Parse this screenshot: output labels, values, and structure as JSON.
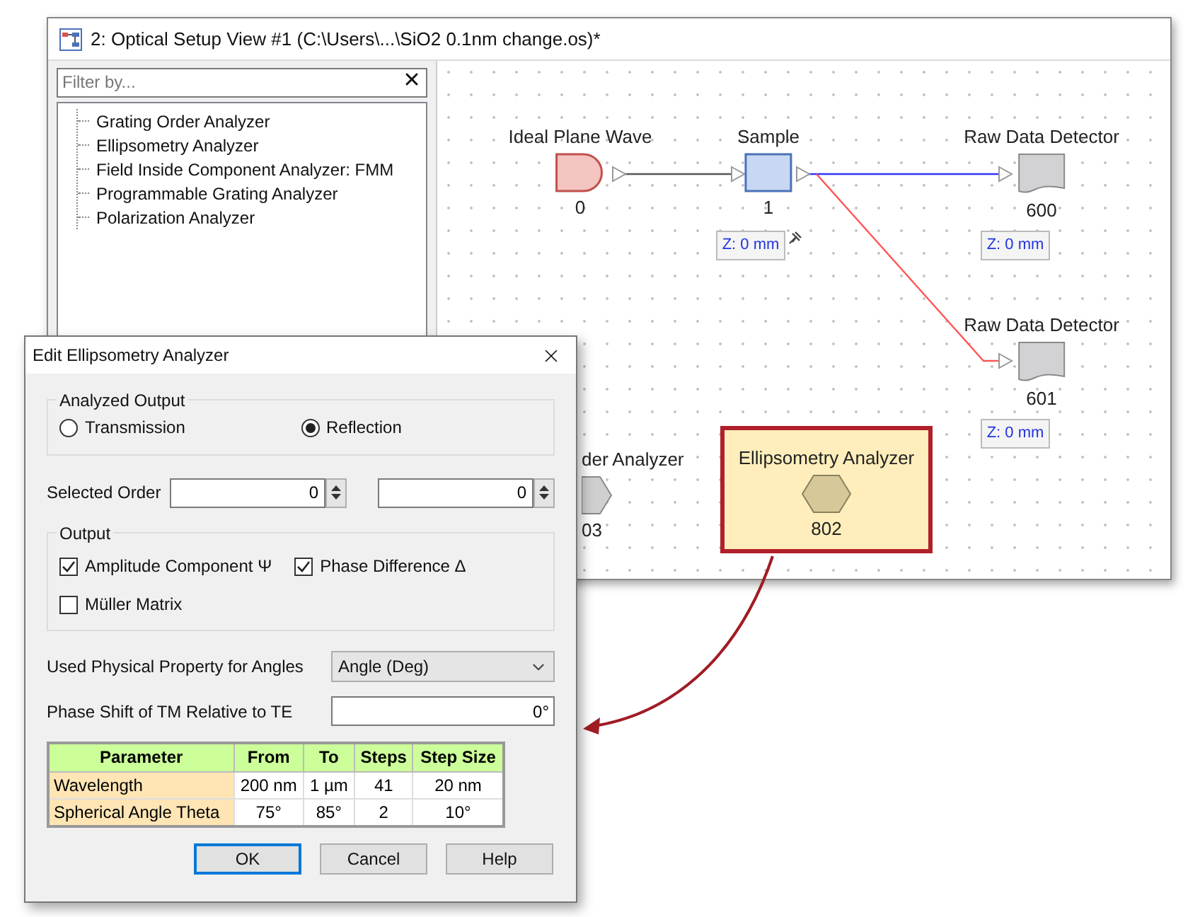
{
  "window": {
    "title": "2: Optical Setup View #1 (C:\\Users\\...\\SiO2 0.1nm change.os)*",
    "filter": {
      "placeholder": "Filter by..."
    },
    "tree": [
      {
        "label": "Grating Order Analyzer"
      },
      {
        "label": "Ellipsometry Analyzer"
      },
      {
        "label": "Field Inside Component Analyzer: FMM"
      },
      {
        "label": "Programmable Grating Analyzer"
      },
      {
        "label": "Polarization Analyzer"
      }
    ],
    "canvas": {
      "nodes": [
        {
          "kind": "source",
          "label": "Ideal Plane Wave",
          "id": "0",
          "selected": false
        },
        {
          "kind": "sample",
          "label": "Sample",
          "id": "1",
          "z": "Z: 0 mm",
          "selected": false
        },
        {
          "kind": "detector",
          "label": "Raw Data Detector",
          "id": "600",
          "z": "Z: 0 mm",
          "selected": false
        },
        {
          "kind": "detector",
          "label": "Raw Data Detector",
          "id": "601",
          "z": "Z: 0 mm",
          "selected": false
        },
        {
          "kind": "analyzer",
          "label": "der Analyzer",
          "id": "03",
          "selected": false
        },
        {
          "kind": "analyzer",
          "label": "Ellipsometry Analyzer",
          "id": "802",
          "selected": true
        }
      ],
      "links": [
        {
          "color": "#555555"
        },
        {
          "color": "#3333ff"
        },
        {
          "color": "#ff5555"
        }
      ]
    }
  },
  "dialog": {
    "title": "Edit Ellipsometry Analyzer",
    "analyzed_output": {
      "legend": "Analyzed Output",
      "options": [
        {
          "label": "Transmission",
          "selected": false
        },
        {
          "label": "Reflection",
          "selected": true
        }
      ]
    },
    "selected_order": {
      "label": "Selected Order",
      "values": [
        "0",
        "0"
      ]
    },
    "output": {
      "legend": "Output",
      "checks": [
        {
          "label": "Amplitude Component Ψ",
          "checked": true
        },
        {
          "label": "Phase Difference Δ",
          "checked": true
        },
        {
          "label": "Müller Matrix",
          "checked": false
        }
      ]
    },
    "angle_property": {
      "label": "Used Physical Property for Angles",
      "value": "Angle (Deg)"
    },
    "phase_shift": {
      "label": "Phase Shift of TM Relative to TE",
      "value": "0°"
    },
    "table": {
      "columns": [
        "Parameter",
        "From",
        "To",
        "Steps",
        "Step Size"
      ],
      "rows": [
        [
          "Wavelength",
          "200 nm",
          "1 µm",
          "41",
          "20 nm"
        ],
        [
          "Spherical Angle Theta",
          "75°",
          "85°",
          "2",
          "10°"
        ]
      ]
    },
    "buttons": [
      {
        "label": "OK",
        "default": true
      },
      {
        "label": "Cancel",
        "default": false
      },
      {
        "label": "Help",
        "default": false
      }
    ]
  }
}
